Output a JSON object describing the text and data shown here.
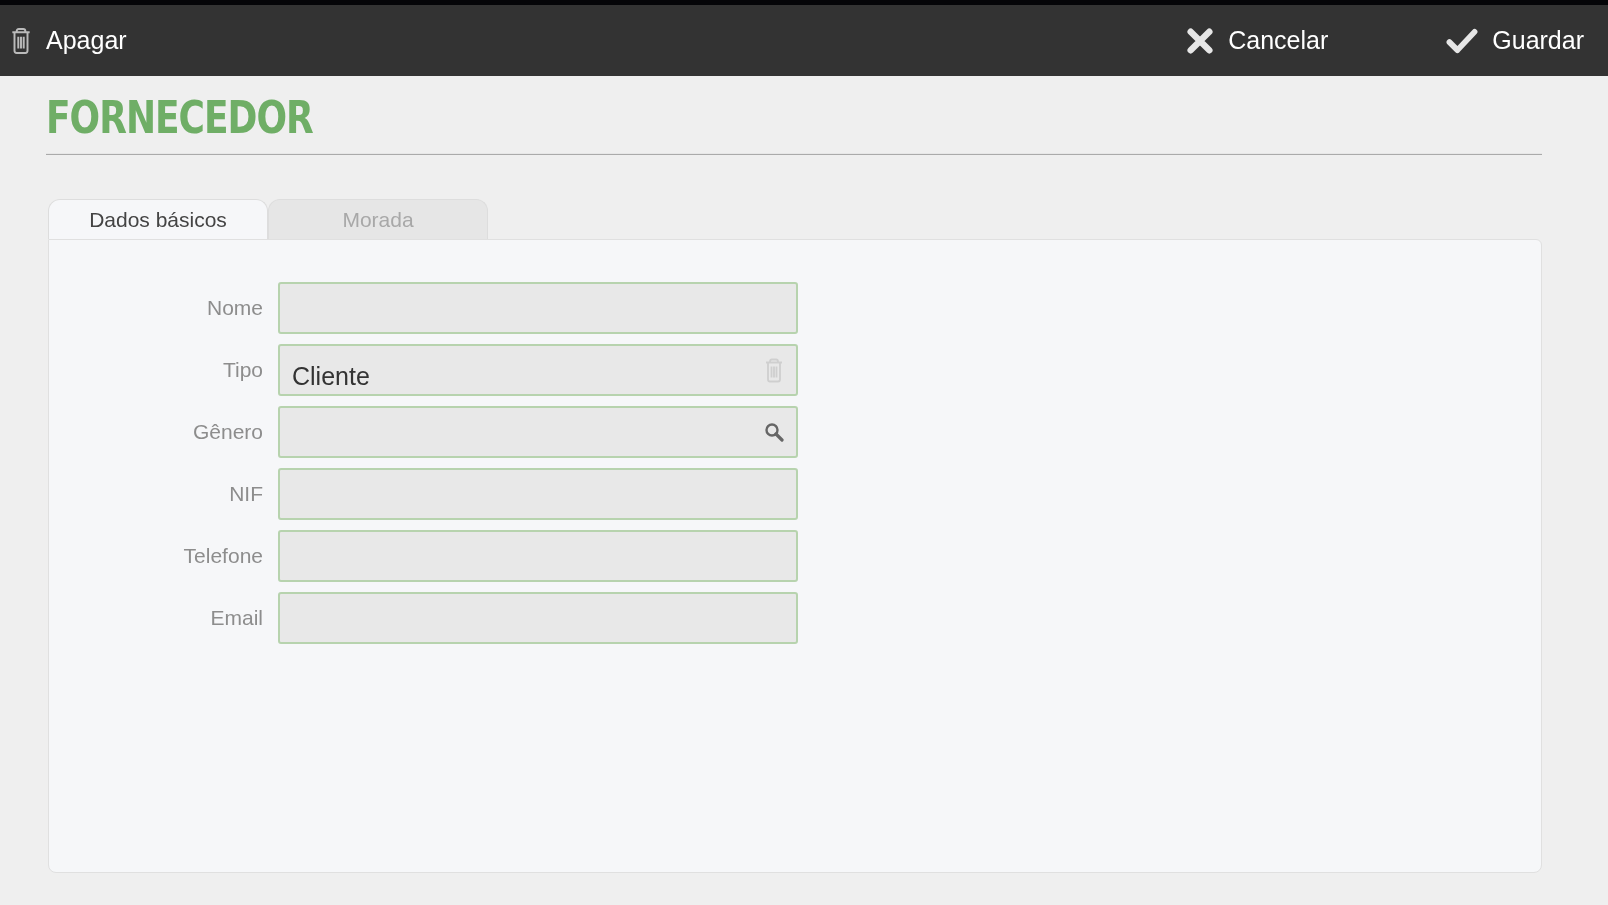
{
  "toolbar": {
    "left": [
      {
        "kind": "delete",
        "label": "Apagar"
      }
    ],
    "right": [
      {
        "kind": "cancel",
        "label": "Cancelar"
      },
      {
        "kind": "save",
        "label": "Guardar"
      }
    ]
  },
  "title": "FORNECEDOR",
  "tabs": [
    {
      "label": "Dados básicos",
      "selected": true
    },
    {
      "label": "Morada",
      "selected": false
    }
  ],
  "fields": [
    {
      "label": "Nome",
      "kind": "text"
    },
    {
      "label": "Tipo",
      "kind": "clearable",
      "value": "Cliente"
    },
    {
      "label": "Gênero",
      "kind": "search"
    },
    {
      "label": "NIF",
      "kind": "text"
    },
    {
      "label": "Telefone",
      "kind": "text"
    },
    {
      "label": "Email",
      "kind": "text"
    }
  ]
}
